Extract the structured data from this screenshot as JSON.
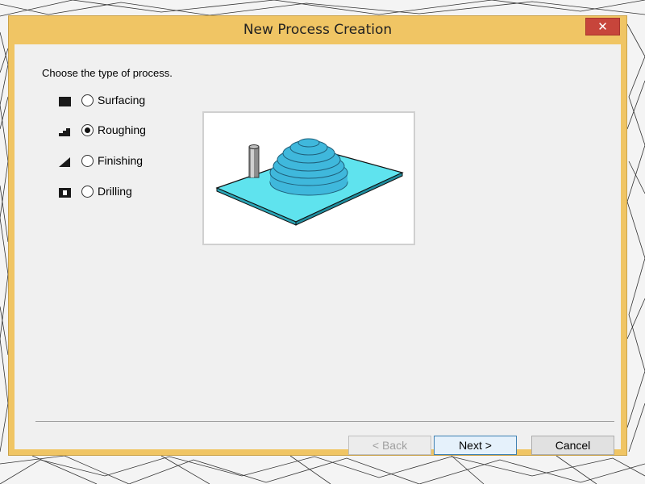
{
  "dialog": {
    "title": "New Process Creation",
    "close_glyph": "✕",
    "prompt": "Choose the type of process.",
    "options": [
      {
        "label": "Surfacing",
        "icon": "surfacing-icon",
        "checked": false
      },
      {
        "label": "Roughing",
        "icon": "roughing-icon",
        "checked": true
      },
      {
        "label": "Finishing",
        "icon": "finishing-icon",
        "checked": false
      },
      {
        "label": "Drilling",
        "icon": "drilling-icon",
        "checked": false
      }
    ],
    "buttons": {
      "back": "< Back",
      "next": "Next >",
      "cancel": "Cancel"
    }
  },
  "colors": {
    "title_bar": "#f0c564",
    "close_button": "#c7453b",
    "preview_plate": "#5fe3ee",
    "preview_dome": "#3fb8dc"
  }
}
